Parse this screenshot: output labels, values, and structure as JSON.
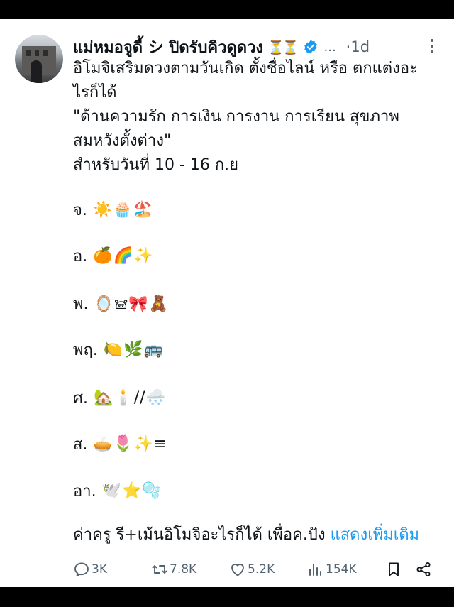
{
  "post": {
    "author_name": "แม่หมอจูดี้ シ ปิดรับคิวดูดวง",
    "status_emoji": "⏳⏳",
    "more_label": "...",
    "time": "·1d",
    "text_line1": "อิโมจิเสริมดวงตามวันเกิด ตั้งชื่อไลน์ หรือ ตกแต่งอะ",
    "text_line2": "ไรก็ได้",
    "text_line3": "\"ด้านความรัก การเงิน การงาน การเรียน สุขภาพ",
    "text_line4": "สมหวังตั้งต่าง\"",
    "text_line5": "สำหรับวันที่ 10 - 16 ก.ย",
    "days": [
      {
        "label": "จ.",
        "emoji": "☀️🧁🏖️"
      },
      {
        "label": "อ.",
        "emoji": "🍊🌈✨"
      },
      {
        "label": "พ.",
        "emoji": "🪞𖠌🎀🧸"
      },
      {
        "label": "พฤ.",
        "emoji": "🍋🌿🚌"
      },
      {
        "label": "ศ.",
        "emoji": "🏡🕯️//🌨️"
      },
      {
        "label": "ส.",
        "emoji": "🥧🌷✨≡"
      },
      {
        "label": "อา.",
        "emoji": "🕊️⭐🫧"
      }
    ],
    "closing_text": "ค่าครู รี+เม้นอิโมจิอะไรก็ได้ เพื่อค.ปัง ",
    "show_more": "แสดงเพิ่มเติม"
  },
  "actions": {
    "replies": "3K",
    "reposts": "7.8K",
    "likes": "5.2K",
    "views": "154K"
  },
  "colors": {
    "text": "#0f1419",
    "secondary": "#536471",
    "link": "#1d9bf0"
  }
}
